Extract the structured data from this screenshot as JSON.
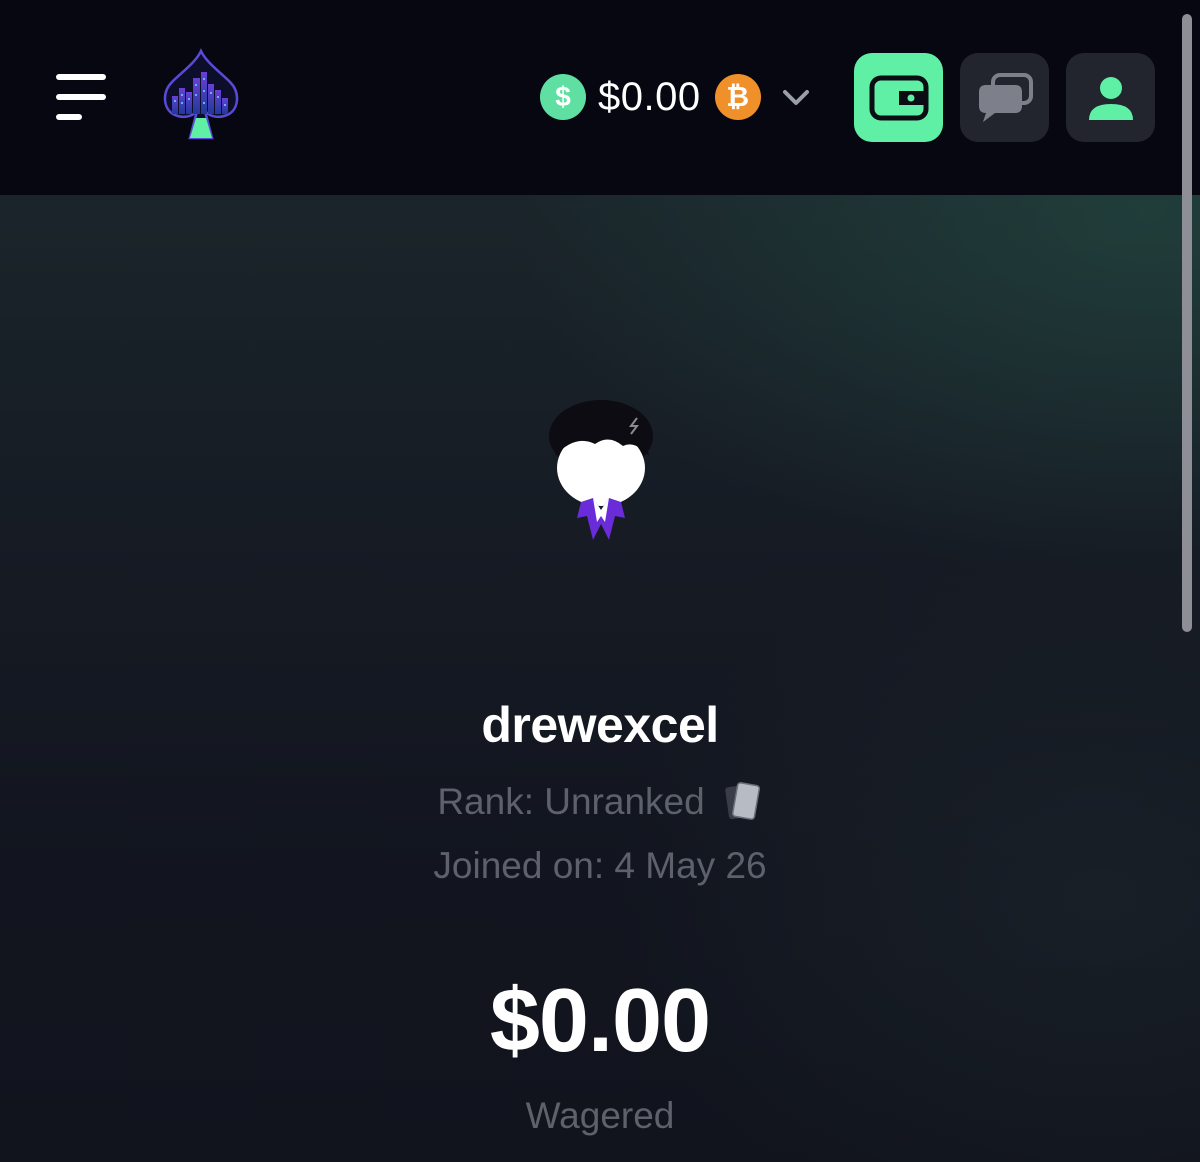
{
  "header": {
    "balance_currency_symbol": "$",
    "balance_amount": "$0.00",
    "crypto_symbol": "₿",
    "icons": {
      "menu": "hamburger-menu-icon",
      "logo": "spade-city-logo",
      "dropdown": "chevron-down-icon",
      "wallet": "wallet-icon",
      "chat": "chat-bubbles-icon",
      "profile": "user-icon"
    }
  },
  "profile": {
    "username": "drewexcel",
    "rank_text": "Rank: Unranked",
    "rank_icon": "cards-rank-icon",
    "joined_text": "Joined on: 4 May 26",
    "wagered_amount": "$0.00",
    "wagered_label": "Wagered"
  },
  "colors": {
    "accent_green": "#5ff0a6",
    "usd_coin": "#5fe0a2",
    "btc_coin": "#f0902b",
    "header_bg": "#060710",
    "muted_text": "#5d616c"
  }
}
